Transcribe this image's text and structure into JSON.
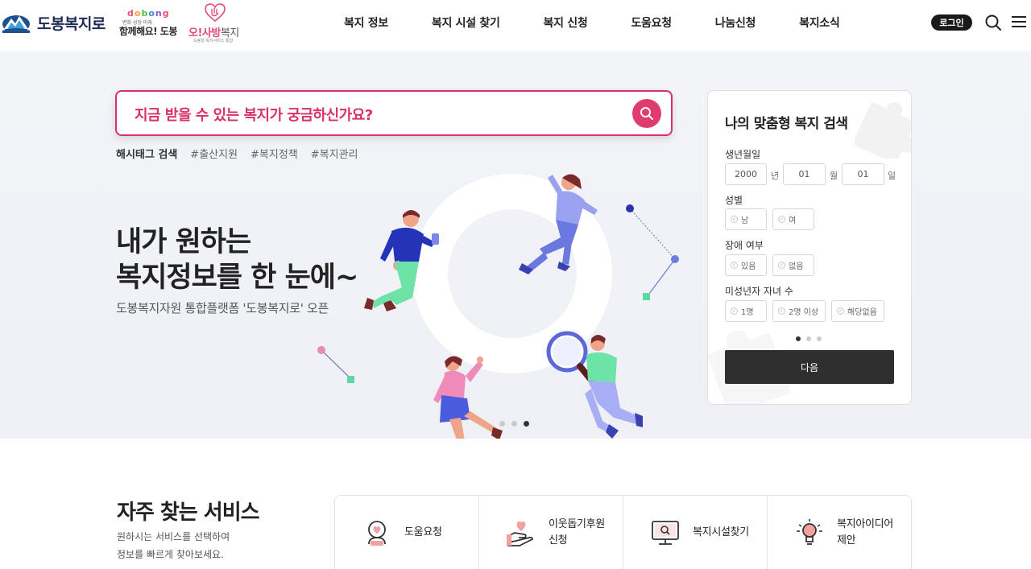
{
  "header": {
    "logo_text": "도봉복지로",
    "dobong_logo": {
      "word": [
        "d",
        "o",
        "b",
        "o",
        "n",
        "g"
      ],
      "sub": "변화·성장·미래",
      "main": "함께해요! 도봉"
    },
    "osa_logo": {
      "o": "오!사방",
      "s": "복지",
      "sub": "도봉형 복지서비스 통합"
    },
    "nav": [
      "복지 정보",
      "복지 시설 찾기",
      "복지 신청",
      "도움요청",
      "나눔신청",
      "복지소식"
    ],
    "login_label": "로그인",
    "icons": [
      "search-icon",
      "menu-icon"
    ]
  },
  "hero": {
    "search_placeholder": "지금 받을 수 있는 복지가 궁금하신가요?",
    "hashtag_title": "해시태그 검색",
    "hashtags": [
      "#출산지원",
      "#복지정책",
      "#복지관리"
    ],
    "title_line1": "내가 원하는",
    "title_line2": "복지정보를 한 눈에~",
    "subtitle": "도봉복지자원 통합플랫폼 '도봉복지로' 오픈",
    "slide_count": 3,
    "active_slide": 3
  },
  "custom_search": {
    "title": "나의 맞춤형 복지 검색",
    "birth_label": "생년월일",
    "birth_year": "2000",
    "birth_month": "01",
    "birth_day": "01",
    "unit_year": "년",
    "unit_month": "월",
    "unit_day": "일",
    "gender_label": "성별",
    "gender_options": [
      "남",
      "여"
    ],
    "disability_label": "장애 여부",
    "disability_options": [
      "있음",
      "없음"
    ],
    "children_label": "미성년자 자녀 수",
    "children_options": [
      "1명",
      "2명 이상",
      "해당없음"
    ],
    "step_count": 3,
    "active_step": 1,
    "next_label": "다음"
  },
  "services": {
    "title": "자주 찾는 서비스",
    "desc_line1": "원하시는 서비스를 선택하여",
    "desc_line2": "정보를 빠르게 찾아보세요.",
    "items": [
      {
        "label": "도움요청",
        "icon": "help-request-icon"
      },
      {
        "label": "이웃돕기후원\n신청",
        "icon": "donation-icon"
      },
      {
        "label": "복지시설찾기",
        "icon": "facility-search-icon"
      },
      {
        "label": "복지아이디어\n제안",
        "icon": "idea-bulb-icon"
      }
    ]
  },
  "colors": {
    "accent": "#e03a6e",
    "dark": "#2f2f2f",
    "hero_bg": "#f0f1f6"
  }
}
